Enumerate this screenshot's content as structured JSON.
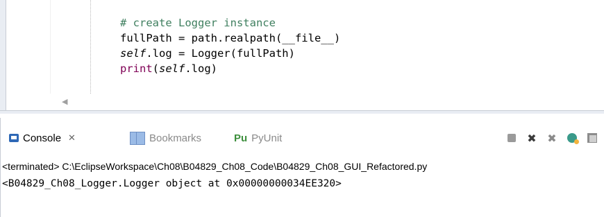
{
  "editor": {
    "lines": [
      {
        "parts": [
          {
            "text": "# create Logger instance",
            "style": "comment"
          }
        ]
      },
      {
        "parts": [
          {
            "text": "fullPath = path.realpath(__file__)",
            "style": "plain"
          }
        ]
      },
      {
        "parts": [
          {
            "text": "self",
            "style": "self"
          },
          {
            "text": ".log = Logger(fullPath)",
            "style": "plain"
          }
        ]
      },
      {
        "parts": [
          {
            "text": "print",
            "style": "builtin"
          },
          {
            "text": "(",
            "style": "plain"
          },
          {
            "text": "self",
            "style": "self"
          },
          {
            "text": ".log)",
            "style": "plain"
          }
        ]
      }
    ],
    "scroll_left_glyph": "◀"
  },
  "console_view": {
    "tabs": [
      {
        "label": "Console",
        "icon": "console-icon",
        "active": true,
        "close": "✕"
      },
      {
        "label": "Bookmarks",
        "icon": "bookmarks-icon",
        "active": false
      },
      {
        "label": "PyUnit",
        "icon": "pyunit-icon",
        "icon_text": "Pu",
        "active": false
      }
    ],
    "toolbar": {
      "remove_glyph": "✖",
      "remove_all_glyph": "✖"
    },
    "status": "<terminated> C:\\EclipseWorkspace\\Ch08\\B04829_Ch08_Code\\B04829_Ch08_GUI_Refactored.py",
    "output": "<B04829_Ch08_Logger.Logger object at 0x00000000034EE320>"
  },
  "colors": {
    "comment": "#3f7f5f",
    "builtin": "#7f0055",
    "frame": "#e9edf3"
  }
}
